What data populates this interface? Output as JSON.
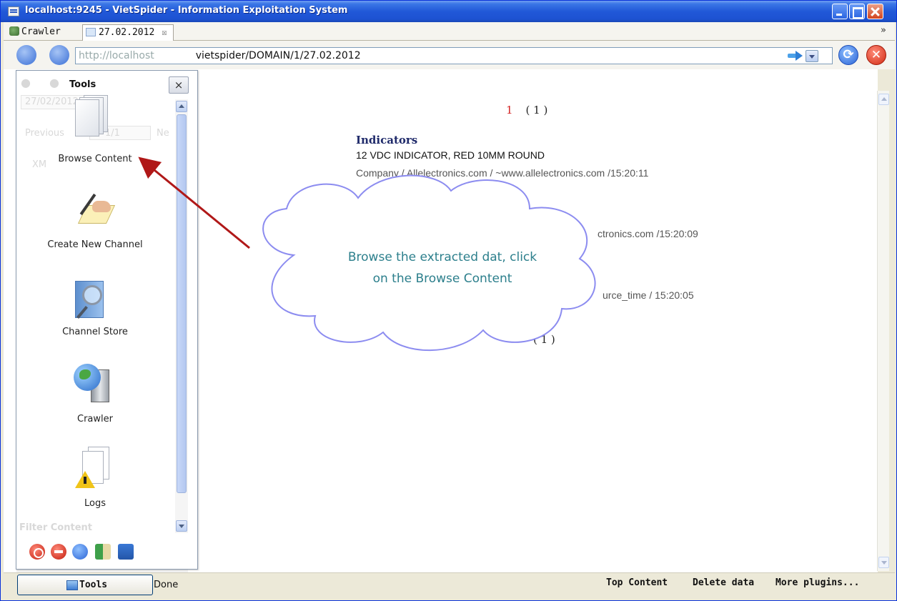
{
  "window": {
    "title": "localhost:9245 - VietSpider - Information Exploitation System"
  },
  "tabs": [
    {
      "label": "Crawler"
    },
    {
      "label": "27.02.2012",
      "close": "☒"
    }
  ],
  "tab_overflow": "»",
  "address_bar": {
    "url_visible": "vietspider/DOMAIN/1/27.02.2012",
    "url_obscured_prefix": "http://localhost"
  },
  "tools_panel": {
    "title": "Tools",
    "close": "×",
    "items": [
      {
        "label": "Browse Content",
        "icon": "pages-stack-icon"
      },
      {
        "label": "Create New Channel",
        "icon": "pen-paper-icon"
      },
      {
        "label": "Channel Store",
        "icon": "book-magnifier-icon"
      },
      {
        "label": "Crawler",
        "icon": "globe-server-icon"
      },
      {
        "label": "Logs",
        "icon": "warning-document-icon"
      }
    ],
    "background_ghost": {
      "date": "27/02/2012",
      "previous": "Previous",
      "page": "1/1",
      "next": "Ne",
      "xml": "XM",
      "filter": "Filter Content"
    }
  },
  "content": {
    "pager_current": "1",
    "pager_total": "( 1 )",
    "pager_bottom": "( 1 )",
    "item": {
      "title": "Indicators",
      "description": "12 VDC INDICATOR, RED 10MM ROUND",
      "meta": "Company / Allelectronics.com / ~www.allelectronics.com /15:20:11"
    },
    "partial_meta_2": "ctronics.com /15:20:09",
    "partial_meta_3": "urce_time / 15:20:05"
  },
  "callout": {
    "line1": "Browse the extracted dat, click",
    "line2": "on the Browse Content"
  },
  "statusbar": {
    "tools_button": "Tools",
    "status": "Done",
    "links": [
      "Top Content",
      "Delete data",
      "More plugins..."
    ]
  }
}
